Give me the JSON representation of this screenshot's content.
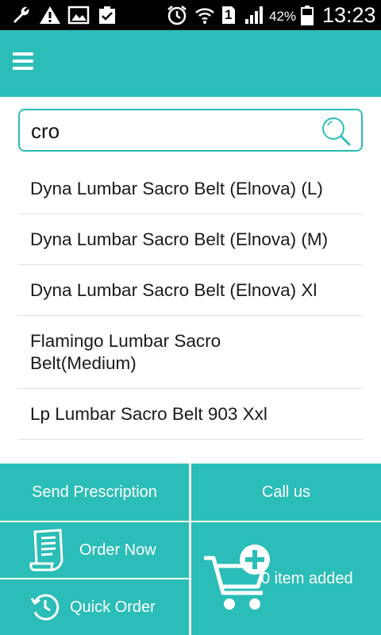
{
  "status_bar": {
    "battery_percent": "42%",
    "time": "13:23",
    "sim_number": "1",
    "icons": [
      "wrench-icon",
      "warning-icon",
      "image-icon",
      "checklist-icon",
      "alarm-icon",
      "wifi-icon",
      "sim-icon",
      "signal-icon",
      "battery-icon"
    ]
  },
  "app_bar": {
    "menu_icon": "hamburger-menu-icon",
    "accent_color": "#2bbdb7"
  },
  "search": {
    "value": "cro",
    "icon": "search-icon"
  },
  "results": [
    "Dyna Lumbar Sacro Belt (Elnova) (L)",
    "Dyna Lumbar Sacro Belt (Elnova) (M)",
    "Dyna Lumbar Sacro Belt (Elnova) Xl",
    "Flamingo Lumbar Sacro Belt(Medium)",
    "Lp Lumbar Sacro Belt 903 Xxl"
  ],
  "actions": {
    "send_prescription": "Send Prescription",
    "call_us": "Call us",
    "order_now": "Order Now",
    "quick_order": "Quick Order",
    "cart_status": "0 item added"
  }
}
